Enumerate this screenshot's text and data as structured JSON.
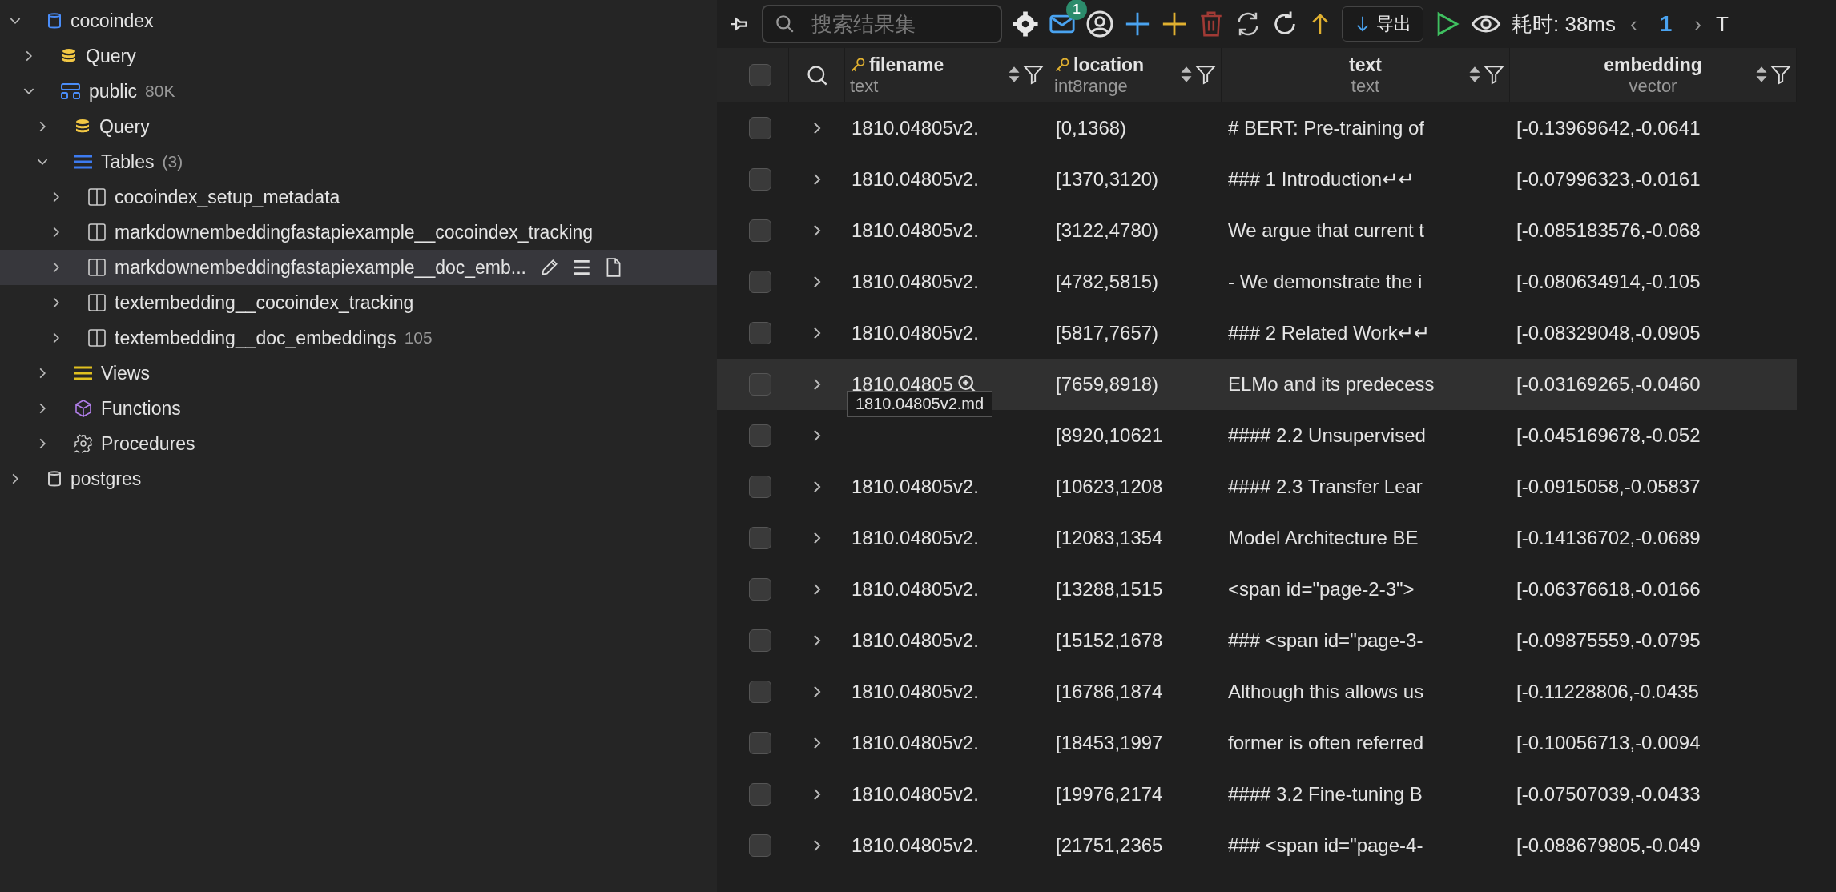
{
  "sidebar": {
    "tree": [
      {
        "label": "cocoindex",
        "kind": "database",
        "expanded": true,
        "children": [
          {
            "label": "Query",
            "kind": "query",
            "expanded": false
          },
          {
            "label": "public",
            "badge": "80K",
            "kind": "schema",
            "expanded": true,
            "children": [
              {
                "label": "Query",
                "kind": "query",
                "expanded": false
              },
              {
                "label": "Tables",
                "badge": "(3)",
                "kind": "tables",
                "expanded": true,
                "children": [
                  {
                    "label": "cocoindex_setup_metadata",
                    "kind": "table",
                    "expanded": false,
                    "selected": false
                  },
                  {
                    "label": "markdownembeddingfastapiexample__cocoindex_tracking",
                    "kind": "table",
                    "expanded": false,
                    "selected": false
                  },
                  {
                    "label": "markdownembeddingfastapiexample__doc_emb...",
                    "kind": "table",
                    "expanded": false,
                    "selected": true
                  },
                  {
                    "label": "textembedding__cocoindex_tracking",
                    "kind": "table",
                    "expanded": false,
                    "selected": false
                  },
                  {
                    "label": "textembedding__doc_embeddings",
                    "badge": "105",
                    "kind": "table",
                    "expanded": false,
                    "selected": false
                  }
                ]
              },
              {
                "label": "Views",
                "kind": "views",
                "expanded": false
              },
              {
                "label": "Functions",
                "kind": "functions",
                "expanded": false
              },
              {
                "label": "Procedures",
                "kind": "procedures",
                "expanded": false
              }
            ]
          }
        ]
      },
      {
        "label": "postgres",
        "kind": "database-grey",
        "expanded": false
      }
    ]
  },
  "toolbar": {
    "search": {
      "placeholder": "搜索结果集"
    },
    "mail_badge": "1",
    "export_button": "导出",
    "timing": "耗时: 38ms",
    "prev": "‹",
    "page": "1",
    "next": "›",
    "cut_label": "T"
  },
  "table": {
    "select_all": {
      "checked": false
    },
    "columns": [
      {
        "name": "filename",
        "type": "text",
        "key": true
      },
      {
        "name": "location",
        "type": "int8range",
        "key": true
      },
      {
        "name": "text",
        "type": "text",
        "key": false
      },
      {
        "name": "embedding",
        "type": "vector",
        "key": false
      }
    ],
    "rows": [
      {
        "checked": false,
        "hovered": false,
        "cells": [
          "1810.04805v2.",
          "[0,1368)",
          "# BERT: Pre-training of",
          "[-0.13969642,-0.0641"
        ]
      },
      {
        "checked": false,
        "hovered": false,
        "cells": [
          "1810.04805v2.",
          "[1370,3120)",
          "### 1 Introduction↵↵",
          "[-0.07996323,-0.0161"
        ]
      },
      {
        "checked": false,
        "hovered": false,
        "cells": [
          "1810.04805v2.",
          "[3122,4780)",
          "We argue that current t",
          "[-0.085183576,-0.068"
        ]
      },
      {
        "checked": false,
        "hovered": false,
        "cells": [
          "1810.04805v2.",
          "[4782,5815)",
          "- We demonstrate the i",
          "[-0.080634914,-0.105"
        ]
      },
      {
        "checked": false,
        "hovered": false,
        "cells": [
          "1810.04805v2.",
          "[5817,7657)",
          "### 2 Related Work↵↵",
          "[-0.08329048,-0.0905"
        ]
      },
      {
        "checked": false,
        "hovered": true,
        "tooltip": "1810.04805v2.md",
        "cells": [
          "1810.04805",
          "[7659,8918)",
          "ELMo and its predecess",
          "[-0.03169265,-0.0460"
        ]
      },
      {
        "checked": false,
        "hovered": false,
        "cells": [
          "",
          "[8920,10621",
          "#### 2.2 Unsupervised",
          "[-0.045169678,-0.052"
        ]
      },
      {
        "checked": false,
        "hovered": false,
        "cells": [
          "1810.04805v2.",
          "[10623,1208",
          "#### 2.3 Transfer Lear",
          "[-0.0915058,-0.05837"
        ]
      },
      {
        "checked": false,
        "hovered": false,
        "cells": [
          "1810.04805v2.",
          "[12083,1354",
          "Model Architecture BE",
          "[-0.14136702,-0.0689"
        ]
      },
      {
        "checked": false,
        "hovered": false,
        "cells": [
          "1810.04805v2.",
          "[13288,1515",
          "<span id=\"page-2-3\">",
          "[-0.06376618,-0.0166"
        ]
      },
      {
        "checked": false,
        "hovered": false,
        "cells": [
          "1810.04805v2.",
          "[15152,1678",
          "### <span id=\"page-3-",
          "[-0.09875559,-0.0795"
        ]
      },
      {
        "checked": false,
        "hovered": false,
        "cells": [
          "1810.04805v2.",
          "[16786,1874",
          "Although this allows us",
          "[-0.11228806,-0.0435"
        ]
      },
      {
        "checked": false,
        "hovered": false,
        "cells": [
          "1810.04805v2.",
          "[18453,1997",
          "former is often referred",
          "[-0.10056713,-0.0094"
        ]
      },
      {
        "checked": false,
        "hovered": false,
        "cells": [
          "1810.04805v2.",
          "[19976,2174",
          "#### 3.2 Fine-tuning B",
          "[-0.07507039,-0.0433"
        ]
      },
      {
        "checked": false,
        "hovered": false,
        "cells": [
          "1810.04805v2.",
          "[21751,2365",
          "### <span id=\"page-4-",
          "[-0.088679805,-0.049"
        ]
      }
    ]
  }
}
